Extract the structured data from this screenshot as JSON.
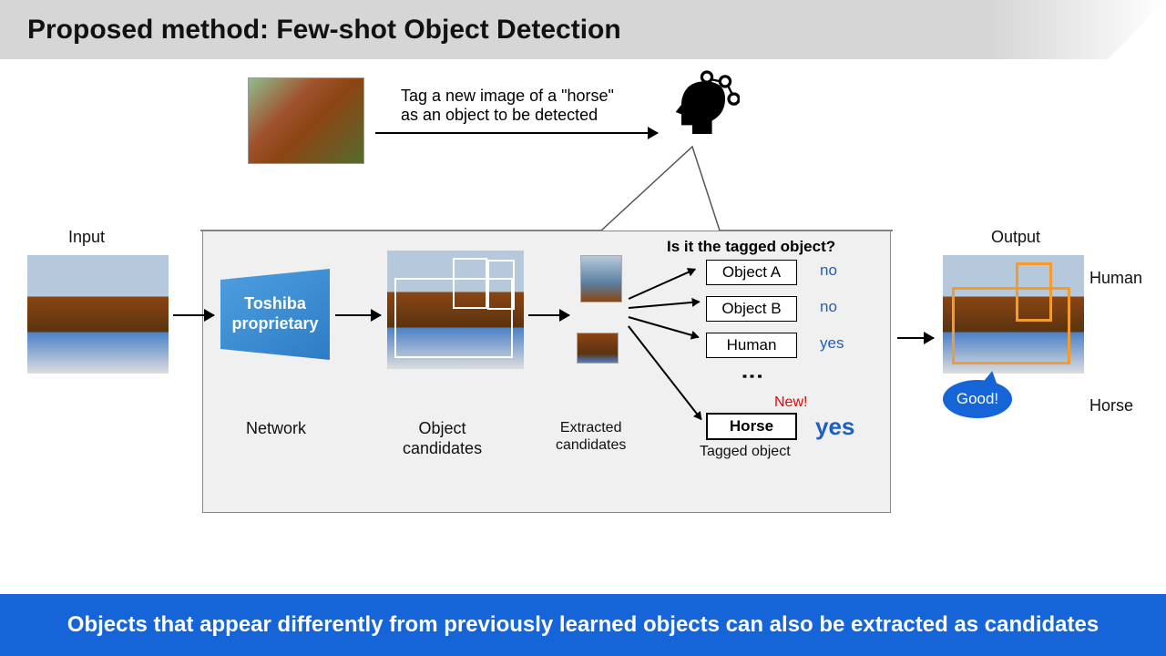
{
  "header": {
    "title": "Proposed method: Few-shot Object Detection"
  },
  "tag_caption": "Tag a new image of a \"horse\"\nas an object to be detected",
  "labels": {
    "input": "Input",
    "network": "Network",
    "object_candidates": "Object\ncandidates",
    "extracted": "Extracted\ncandidates",
    "question": "Is it the tagged object?",
    "tagged_object": "Tagged object",
    "output": "Output",
    "trap": "Toshiba proprietary",
    "good": "Good!"
  },
  "candidates": [
    {
      "name": "Object A",
      "answer": "no",
      "bold": false
    },
    {
      "name": "Object B",
      "answer": "no",
      "bold": false
    },
    {
      "name": "Human",
      "answer": "yes",
      "bold": false
    },
    {
      "name": "Horse",
      "answer": "yes",
      "bold": true,
      "flag": "New!"
    }
  ],
  "output_labels": {
    "human": "Human",
    "horse": "Horse"
  },
  "footer": "Objects that appear differently from previously learned objects can also be extracted as candidates"
}
